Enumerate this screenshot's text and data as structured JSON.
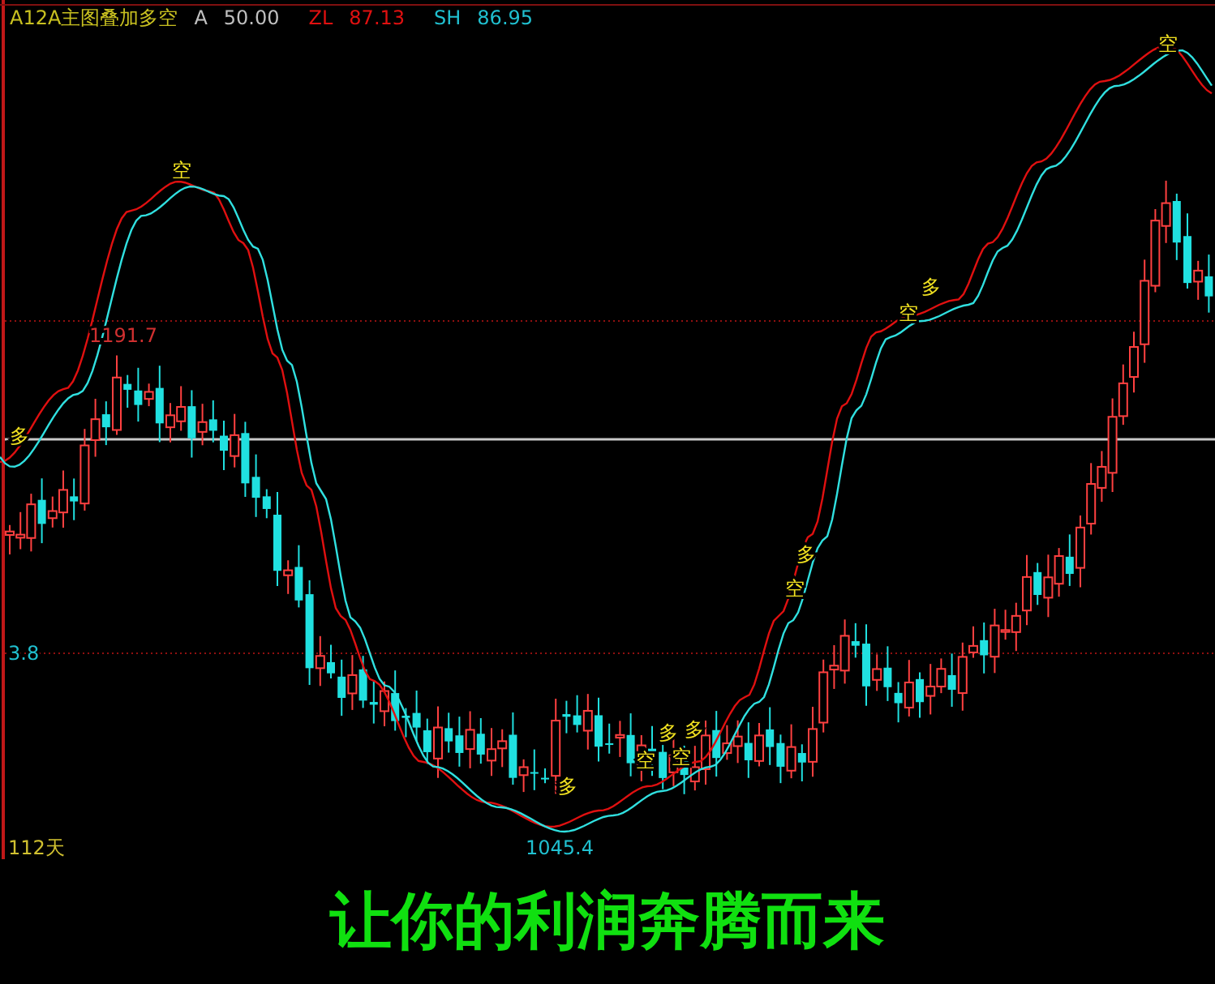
{
  "header": {
    "title": "A12A主图叠加多空",
    "items": [
      {
        "label": "A",
        "value": "50.00",
        "color": "#c0c0c0"
      },
      {
        "label": "ZL",
        "value": "87.13",
        "color": "#e01010"
      },
      {
        "label": "SH",
        "value": "86.95",
        "color": "#20c0d0"
      }
    ]
  },
  "price_labels": [
    {
      "text": "1191.7"
    },
    {
      "text": "3.8"
    },
    {
      "text": "1045.4"
    }
  ],
  "period_label": "112天",
  "signals": [
    {
      "text": "多"
    },
    {
      "text": "空"
    },
    {
      "text": "多"
    },
    {
      "text": "空"
    },
    {
      "text": "空"
    },
    {
      "text": "多"
    },
    {
      "text": "多"
    },
    {
      "text": "空"
    },
    {
      "text": "多"
    },
    {
      "text": "空"
    },
    {
      "text": "多"
    },
    {
      "text": "空"
    }
  ],
  "caption": "让你的利润奔腾而来"
}
